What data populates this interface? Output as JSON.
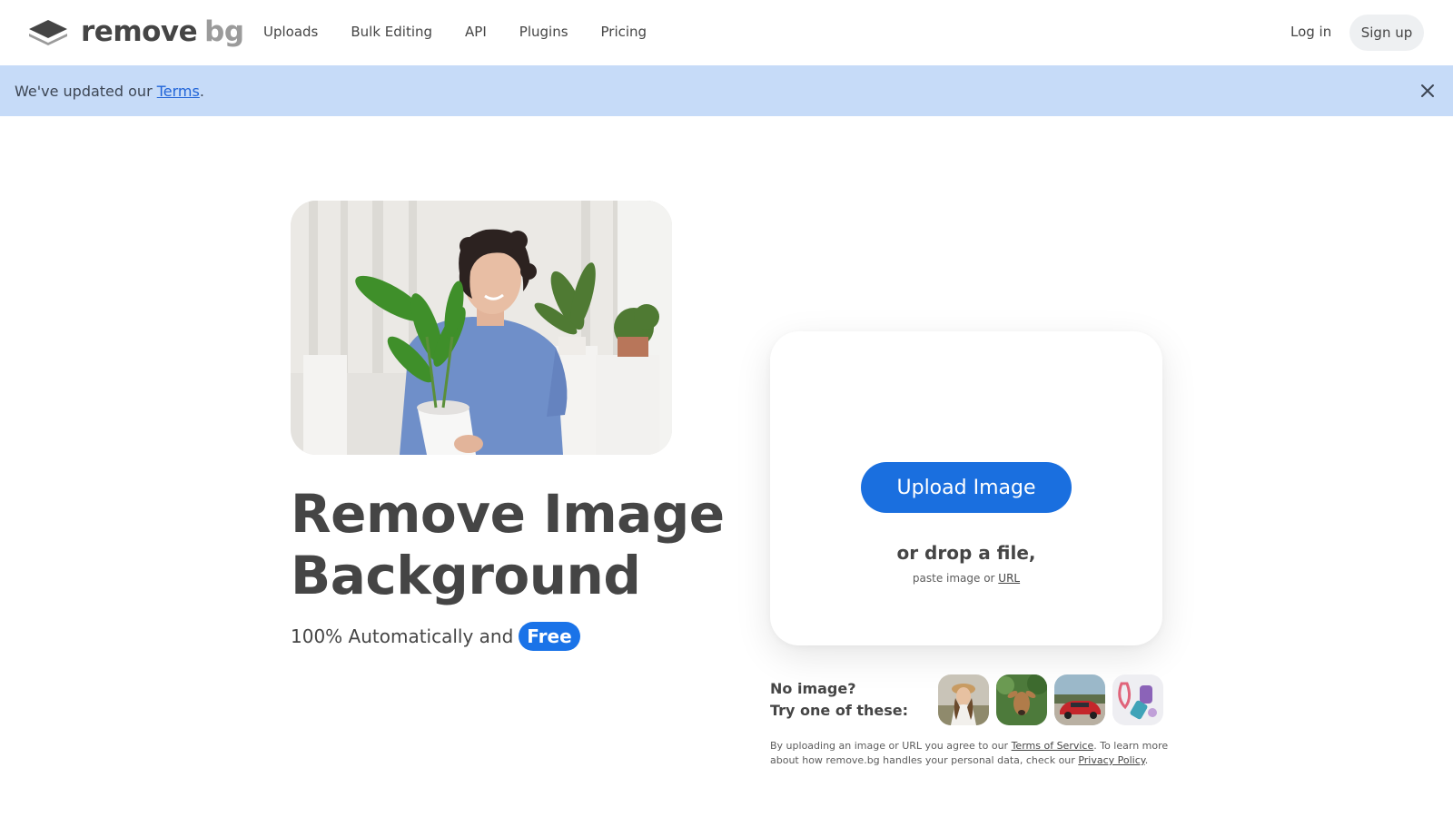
{
  "header": {
    "logo": {
      "remove": "remove",
      "bg": "bg"
    },
    "nav": [
      {
        "label": "Uploads"
      },
      {
        "label": "Bulk Editing"
      },
      {
        "label": "API"
      },
      {
        "label": "Plugins"
      },
      {
        "label": "Pricing"
      }
    ],
    "login": "Log in",
    "signup": "Sign up"
  },
  "banner": {
    "prefix": "We've updated our ",
    "link": "Terms",
    "suffix": "."
  },
  "hero": {
    "headline_line1": "Remove Image",
    "headline_line2": "Background",
    "subline": "100% Automatically and",
    "badge": "Free"
  },
  "upload": {
    "button": "Upload Image",
    "drop": "or drop a file,",
    "paste_prefix": "paste image or ",
    "paste_link": "URL"
  },
  "samples": {
    "line1": "No image?",
    "line2": "Try one of these:"
  },
  "legal": {
    "part1": "By uploading an image or URL you agree to our ",
    "tos": "Terms of Service",
    "part2": ". To learn more about how remove.bg handles your personal data, check our ",
    "privacy": "Privacy Policy",
    "part3": "."
  },
  "colors": {
    "primary": "#1a6fdf",
    "banner_bg": "#c6dbf8",
    "text": "#454545"
  }
}
